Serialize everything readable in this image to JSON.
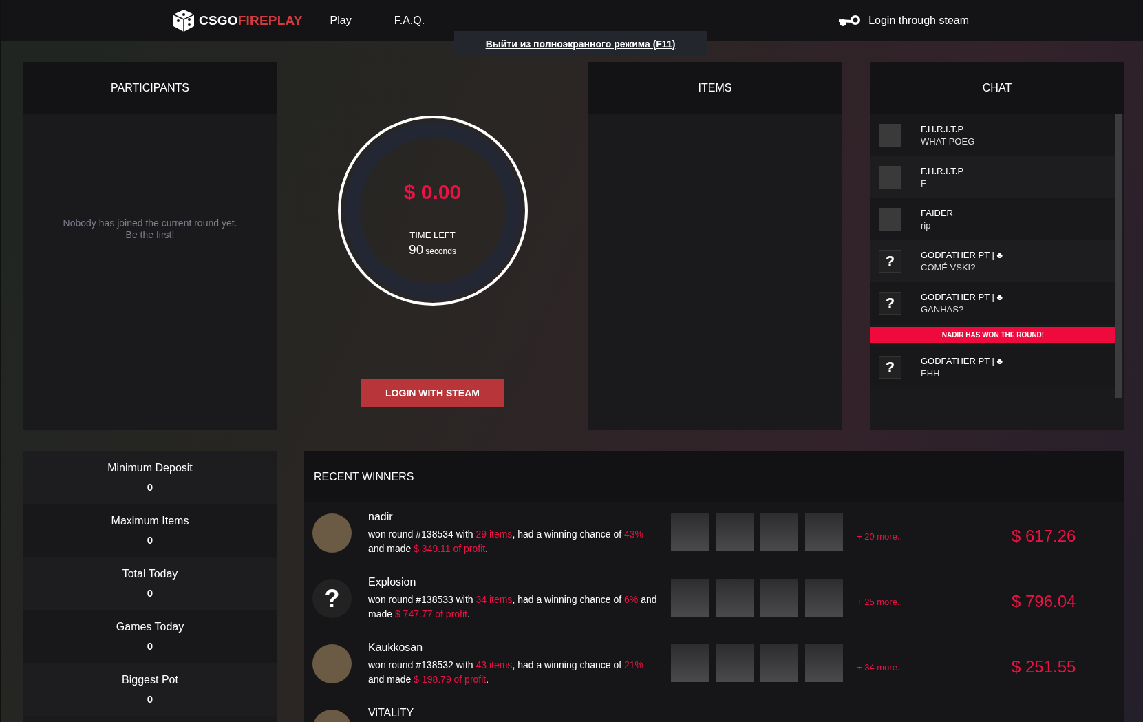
{
  "nav": {
    "logo": [
      "CSGO",
      "FIREPLAY"
    ],
    "links": [
      {
        "label": "Play"
      },
      {
        "label": "F.A.Q."
      }
    ],
    "login": "Login through steam"
  },
  "fullscreen_notice": "Выйти из полноэкранного режима (F11)",
  "participants": {
    "title": "PARTICIPANTS",
    "empty_message": [
      "Nobody has joined the current round yet.",
      "Be the first!"
    ]
  },
  "pot": {
    "amount": "$ 0.00",
    "time_label": "TIME LEFT",
    "time_value": "90",
    "time_unit": "seconds",
    "button": "LOGIN WITH STEAM"
  },
  "items": {
    "title": "ITEMS"
  },
  "chat": {
    "title": "CHAT",
    "messages": [
      {
        "kind": "message",
        "name": "F.H.R.I.T.P",
        "text": "WHAT POEG"
      },
      {
        "kind": "message",
        "name": "F.H.R.I.T.P",
        "text": "F"
      },
      {
        "kind": "message",
        "name": "FAIDER",
        "text": "rip"
      },
      {
        "kind": "message",
        "avatar_text": "?",
        "name": "GODFATHER PT | ♣",
        "text": "COMÉ VSKI?"
      },
      {
        "kind": "message",
        "avatar_text": "?",
        "name": "GODFATHER PT | ♣",
        "text": "GANHAS?"
      },
      {
        "kind": "announcement",
        "text": "NADIR HAS WON THE ROUND!"
      },
      {
        "kind": "message",
        "avatar_text": "?",
        "name": "GODFATHER PT | ♣",
        "text": "EHH"
      }
    ]
  },
  "stats": [
    {
      "label": "Minimum Deposit",
      "value": "0"
    },
    {
      "label": "Maximum Items",
      "value": "0"
    },
    {
      "label": "Total Today",
      "value": "0"
    },
    {
      "label": "Games Today",
      "value": "0"
    },
    {
      "label": "Biggest Pot",
      "value": "0"
    }
  ],
  "recent_winners": {
    "title": "RECENT WINNERS",
    "rows": [
      {
        "name": "nadir",
        "description": [
          {
            "text": "won round #138534 with ",
            "highlight": false
          },
          {
            "text": "29 items",
            "highlight": true
          },
          {
            "text": ", had a winning chance of ",
            "highlight": false
          },
          {
            "text": "43%",
            "highlight": true
          },
          {
            "text": " and made ",
            "highlight": false
          },
          {
            "text": "$ 349.11 of profit",
            "highlight": true
          },
          {
            "text": ".",
            "highlight": false
          }
        ],
        "more": "+ 20 more..",
        "total": "$ 617.26"
      },
      {
        "avatar_text": "?",
        "name": "Explosion",
        "description": [
          {
            "text": "won round #138533 with ",
            "highlight": false
          },
          {
            "text": "34 items",
            "highlight": true
          },
          {
            "text": ", had a winning chance of ",
            "highlight": false
          },
          {
            "text": "6%",
            "highlight": true
          },
          {
            "text": " and made ",
            "highlight": false
          },
          {
            "text": "$ 747.77 of profit",
            "highlight": true
          },
          {
            "text": ".",
            "highlight": false
          }
        ],
        "more": "+ 25 more..",
        "total": "$ 796.04"
      },
      {
        "name": "Kaukkosan",
        "description": [
          {
            "text": "won round #138532 with ",
            "highlight": false
          },
          {
            "text": "43 items",
            "highlight": true
          },
          {
            "text": ", had a winning chance of ",
            "highlight": false
          },
          {
            "text": "21%",
            "highlight": true
          },
          {
            "text": " and made ",
            "highlight": false
          },
          {
            "text": "$ 198.79 of profit",
            "highlight": true
          },
          {
            "text": ".",
            "highlight": false
          }
        ],
        "more": "+ 34 more..",
        "total": "$ 251.55"
      },
      {
        "name": "ViTALiTY"
      }
    ]
  }
}
